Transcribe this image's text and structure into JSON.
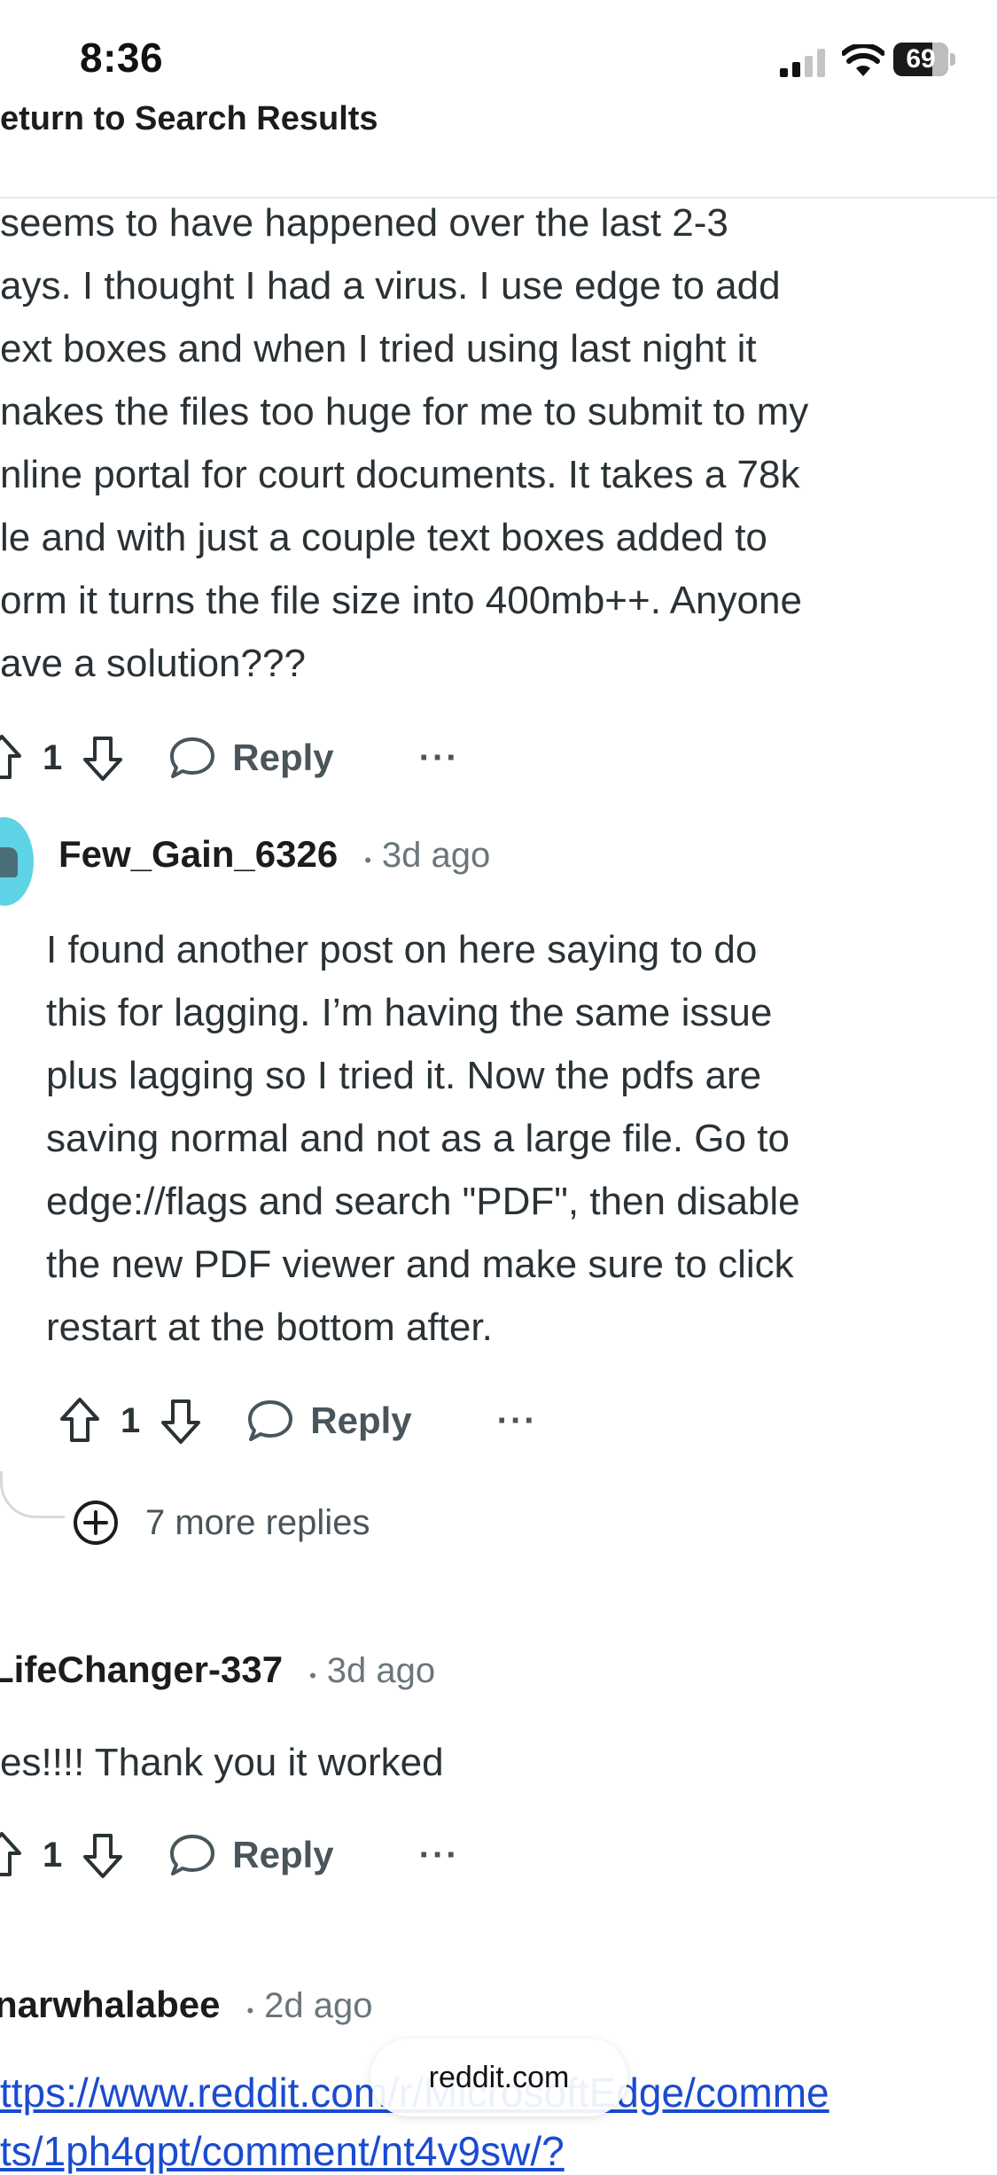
{
  "status": {
    "time": "8:36",
    "battery": "69"
  },
  "header": {
    "back_label": "eturn to Search Results"
  },
  "post": {
    "lines": [
      " seems to have happened over the last 2-3",
      "ays. I thought I had a virus. I use edge to add",
      "ext boxes and when I tried using last night it",
      "nakes the files too huge for me to submit to my",
      "nline portal for court documents. It takes a 78k",
      "le and with just a couple text boxes added to",
      "orm it turns the file size into 400mb++. Anyone",
      "ave a solution???"
    ],
    "votes": "1",
    "reply_label": "Reply",
    "more_label": "···"
  },
  "comment1": {
    "author": "Few_Gain_6326",
    "dot": "•",
    "time": "3d ago",
    "lines": [
      "I found another post on here saying to do",
      "this for lagging. I’m having the same issue",
      "plus lagging so I tried it. Now the pdfs are",
      "saving normal and not as a large file.  Go to",
      "edge://flags and search \"PDF\", then disable",
      "the new PDF viewer and make sure to click",
      "restart at the bottom after."
    ],
    "votes": "1",
    "reply_label": "Reply",
    "more_label": "···",
    "more_replies": "7 more replies"
  },
  "comment2": {
    "author": "LifeChanger-337",
    "dot": "•",
    "time": "3d ago",
    "text": "es!!!! Thank you it worked",
    "votes": "1",
    "reply_label": "Reply",
    "more_label": "···"
  },
  "comment3": {
    "author": "narwhalabee",
    "dot": "•",
    "time": "2d ago",
    "link_line1": "ttps://www.reddit.com/r/MicrosoftEdge/comme",
    "link_line2": "ts/1ph4qpt/comment/nt4v9sw/?"
  },
  "browser": {
    "url": "reddit.com"
  },
  "icons": {
    "upvote": "arrow-up-icon",
    "downvote": "arrow-down-icon",
    "reply": "speech-bubble-icon",
    "more_replies": "plus-circle-icon"
  }
}
